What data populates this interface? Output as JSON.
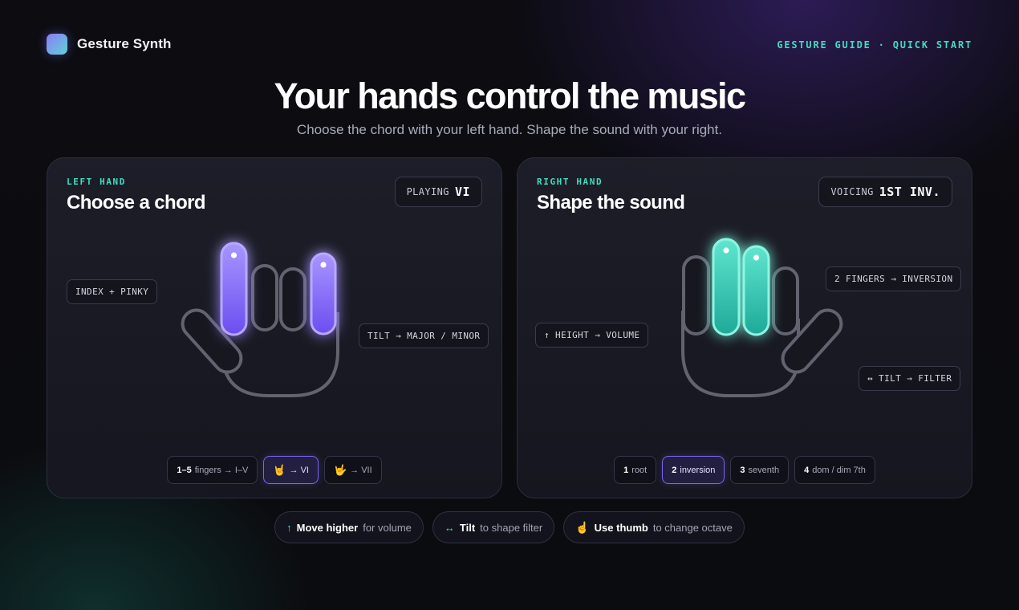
{
  "app": {
    "name": "Gesture Synth",
    "nav": "GESTURE GUIDE · QUICK START"
  },
  "hero": {
    "title": "Your hands control the music",
    "subtitle": "Choose the chord with your left hand. Shape the sound with your right."
  },
  "left_card": {
    "eyebrow": "LEFT HAND",
    "title": "Choose a chord",
    "status_label": "PLAYING",
    "status_value": "VI",
    "tags": {
      "index_pinky": "INDEX + PINKY",
      "tilt": "TILT → MAJOR / MINOR"
    },
    "chips": [
      {
        "strong": "1–5",
        "text": "fingers → I–V",
        "emoji": ""
      },
      {
        "strong": "",
        "text": "→ VI",
        "emoji": "🤘"
      },
      {
        "strong": "",
        "text": "→ VII",
        "emoji": "🤟"
      }
    ],
    "active_chip": 1
  },
  "right_card": {
    "eyebrow": "RIGHT HAND",
    "title": "Shape the sound",
    "status_label": "VOICING",
    "status_value": "1ST INV.",
    "tags": {
      "fingers": "2 FINGERS → INVERSION",
      "height": "↑ HEIGHT → VOLUME",
      "tilt": "↔ TILT → FILTER"
    },
    "chips": [
      {
        "strong": "1",
        "text": "root"
      },
      {
        "strong": "2",
        "text": "inversion"
      },
      {
        "strong": "3",
        "text": "seventh"
      },
      {
        "strong": "4",
        "text": "dom / dim 7th"
      }
    ],
    "active_chip": 1
  },
  "hints": [
    {
      "icon": "↑",
      "strong": "Move higher",
      "text": "for volume"
    },
    {
      "icon": "↔",
      "strong": "Tilt",
      "text": "to shape filter"
    },
    {
      "icon": "☝️",
      "strong": "Use thumb",
      "text": "to change octave"
    }
  ],
  "colors": {
    "accent_teal": "#42dcc0",
    "accent_violet": "#8b7cf7",
    "background": "#0b0c10",
    "card": "#1c1d28"
  }
}
